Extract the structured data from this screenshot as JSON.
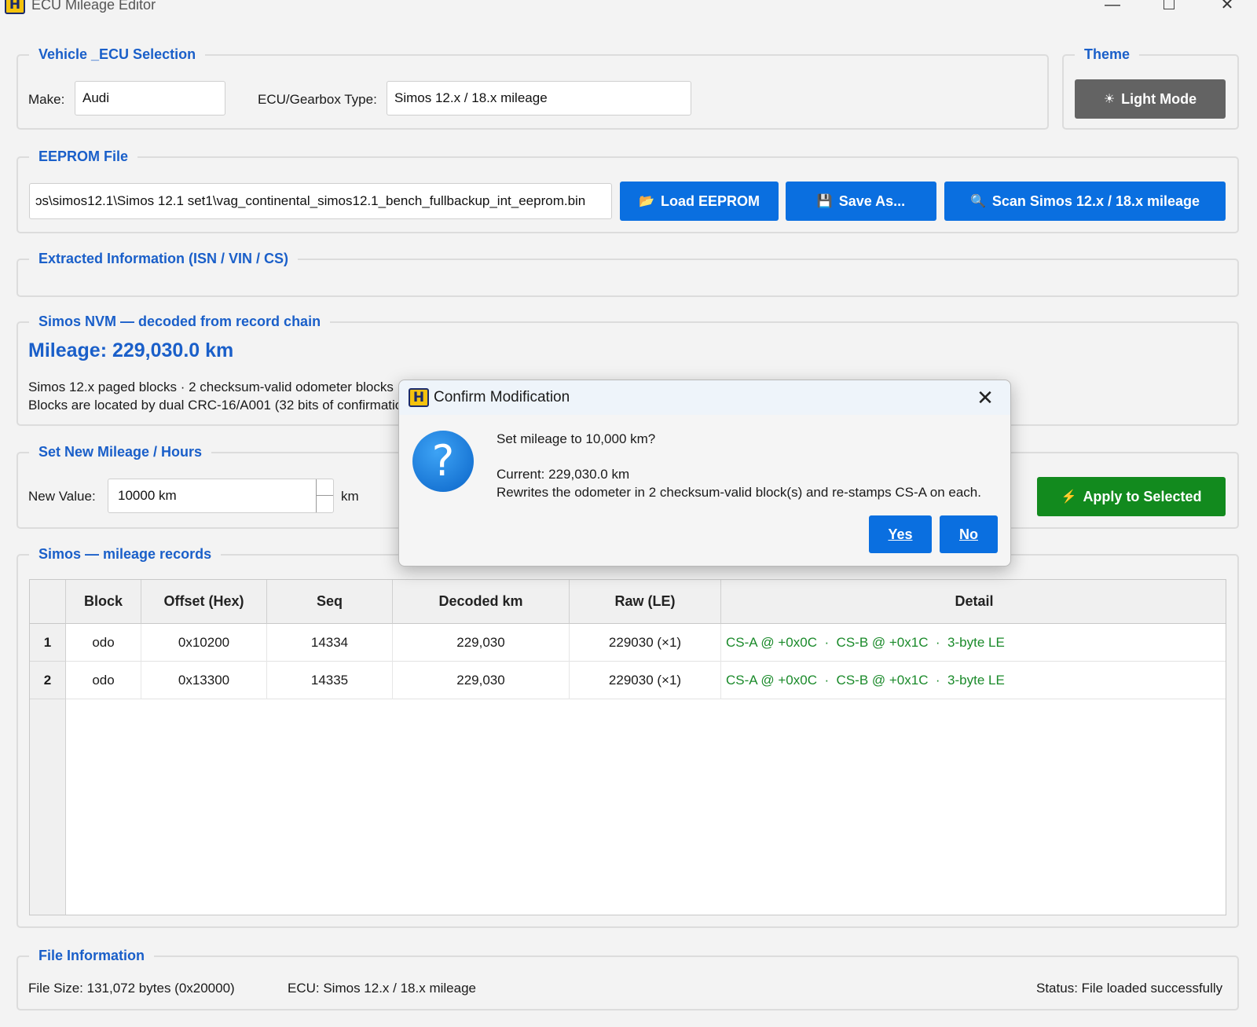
{
  "window": {
    "title": "ECU Mileage Editor",
    "icon_glyph": "H"
  },
  "vehicle": {
    "title": "Vehicle _ECU Selection",
    "make_label": "Make:",
    "make_value": "Audi",
    "ecu_label": "ECU/Gearbox Type:",
    "ecu_value": "Simos 12.x / 18.x mileage"
  },
  "theme": {
    "title": "Theme",
    "button_label": "Light Mode",
    "button_icon": "☀"
  },
  "eeprom": {
    "title": "EEPROM File",
    "path": "ɔs\\simos12.1\\Simos 12.1 set1\\vag_continental_simos12.1_bench_fullbackup_int_eeprom.bin",
    "load_label": "Load EEPROM",
    "load_icon": "📂",
    "save_label": "Save As...",
    "save_icon": "💾",
    "scan_label": "Scan Simos 12.x / 18.x mileage",
    "scan_icon": "🔍"
  },
  "extracted": {
    "title": "Extracted Information (ISN / VIN / CS)"
  },
  "nvm": {
    "title": "Simos NVM — decoded from record chain",
    "mileage": "Mileage: 229,030.0 km",
    "line1": "Simos 12.x paged blocks  ·  2 checksum-valid odometer blocks",
    "line2": "Blocks are located by dual CRC-16/A001 (32 bits of confirmation)"
  },
  "new_mileage": {
    "title": "Set New Mileage / Hours",
    "label": "New Value:",
    "value": "10000 km",
    "unit": "km",
    "apply_label": "Apply to Selected",
    "apply_icon": "⚡"
  },
  "records": {
    "title": "Simos — mileage records",
    "columns": [
      "Block",
      "Offset (Hex)",
      "Seq",
      "Decoded km",
      "Raw (LE)",
      "Detail"
    ],
    "rows": [
      {
        "num": "1",
        "block": "odo",
        "offset": "0x10200",
        "seq": "14334",
        "decoded": "229,030",
        "raw": "229030 (×1)",
        "detail": "CS-A @ +0x0C  ·  CS-B @ +0x1C  ·  3-byte LE"
      },
      {
        "num": "2",
        "block": "odo",
        "offset": "0x13300",
        "seq": "14335",
        "decoded": "229,030",
        "raw": "229030 (×1)",
        "detail": "CS-A @ +0x0C  ·  CS-B @ +0x1C  ·  3-byte LE"
      }
    ]
  },
  "file_info": {
    "title": "File Information",
    "size": "File Size: 131,072 bytes (0x20000)",
    "ecu": "ECU: Simos 12.x / 18.x mileage",
    "status": "Status: File loaded successfully"
  },
  "dialog": {
    "title": "Confirm Modification",
    "question": "Set mileage to 10,000 km?",
    "current": "Current: 229,030.0 km",
    "detail": "Rewrites the odometer in 2 checksum-valid block(s) and re-stamps CS-A on each.",
    "yes_label": "Yes",
    "no_label": "No",
    "icon_glyph": "?",
    "close_glyph": "✕"
  },
  "colors": {
    "accent_blue": "#0a6fe0",
    "title_blue": "#1a5fc9",
    "apply_green": "#128a1e",
    "detail_green": "#1a8a2a",
    "theme_gray": "#636363"
  }
}
